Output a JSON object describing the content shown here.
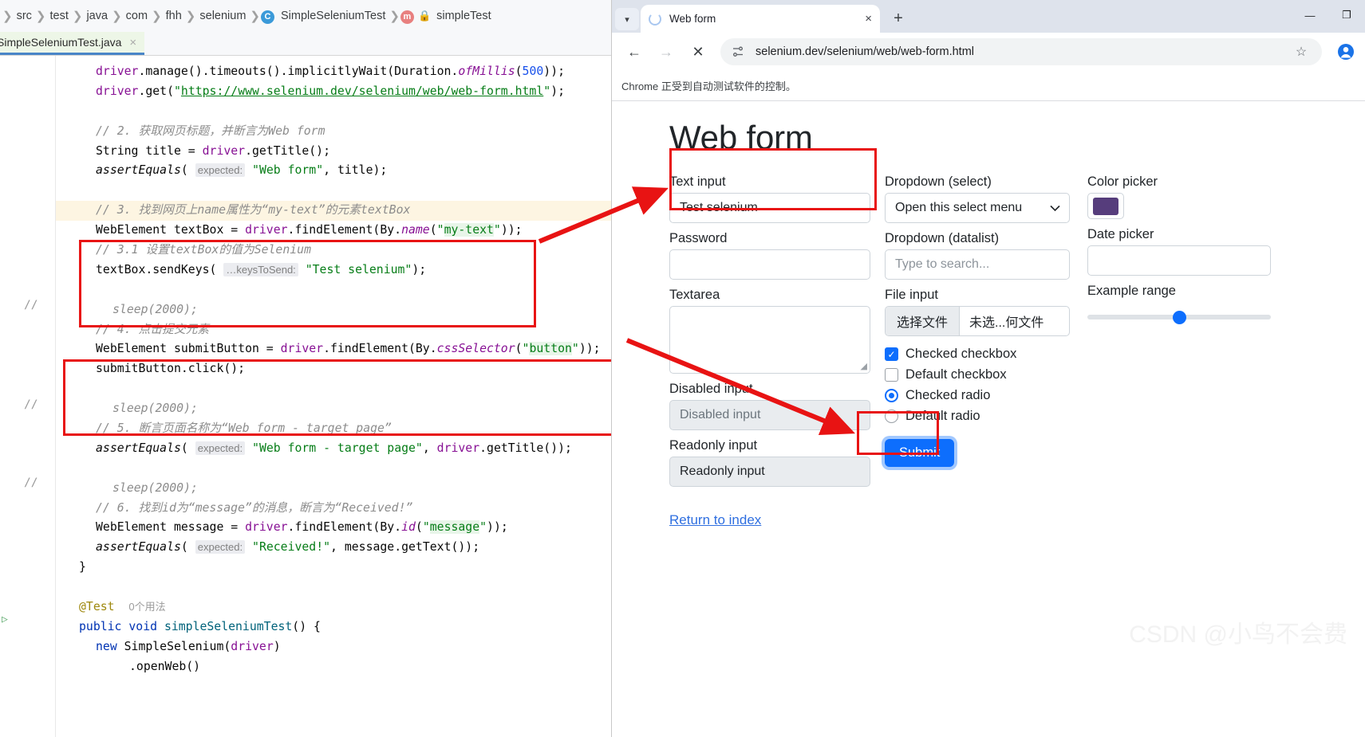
{
  "ide": {
    "breadcrumb": [
      {
        "label": "src",
        "icon": null
      },
      {
        "label": "test",
        "icon": null
      },
      {
        "label": "java",
        "icon": null
      },
      {
        "label": "com",
        "icon": null
      },
      {
        "label": "fhh",
        "icon": null
      },
      {
        "label": "selenium",
        "icon": null
      },
      {
        "label": "SimpleSeleniumTest",
        "icon": "class-icon"
      },
      {
        "label": "simpleTest",
        "icon": "method-icon"
      }
    ],
    "tab": {
      "label": "SimpleSeleniumTest.java",
      "close": "×"
    },
    "code_lines": [
      {
        "indent": 2,
        "html": "<span class='id'>driver</span>.manage().timeouts().implicitlyWait(Duration.<span class='idi'>ofMillis</span>(<span class='n'>500</span>));"
      },
      {
        "indent": 2,
        "html": "<span class='id'>driver</span>.get(<span class='s'>\"</span><span class='link'>https://www.selenium.dev/selenium/web/web-form.html</span><span class='s'>\"</span>);"
      },
      {
        "indent": 0,
        "html": ""
      },
      {
        "indent": 2,
        "html": "<span class='cm'>// 2. 获取网页标题，并断言为Web form</span>"
      },
      {
        "indent": 2,
        "html": "String title = <span class='id'>driver</span>.getTitle();"
      },
      {
        "indent": 2,
        "html": "<span class='ital'>assertEquals</span>( <span class='hint'>expected:</span> <span class='s'>\"Web form\"</span>, title);"
      },
      {
        "indent": 0,
        "html": ""
      },
      {
        "indent": 2,
        "html": "<span class='cm'>// 3. 找到网页上name属性为“my-text”的元素textBox</span>",
        "highlight": true
      },
      {
        "indent": 2,
        "html": "WebElement textBox = <span class='id'>driver</span>.findElement(By.<span class='idi'>name</span>(<span class='s'>\"</span><span class='s green-hl'>my-text</span><span class='s'>\"</span>));"
      },
      {
        "indent": 2,
        "html": "<span class='cm'>// 3.1 设置textBox的值为Selenium</span>"
      },
      {
        "indent": 2,
        "html": "textBox.sendKeys( <span class='hint'>…keysToSend:</span> <span class='s'>\"Test selenium\"</span>);"
      },
      {
        "indent": 0,
        "html": ""
      },
      {
        "indent": 3,
        "html": "<span class='cm'>sleep(2000);</span>"
      },
      {
        "indent": 2,
        "html": "<span class='cm'>// 4. 点击提交元素</span>"
      },
      {
        "indent": 2,
        "html": "WebElement submitButton = <span class='id'>driver</span>.findElement(By.<span class='idi'>cssSelector</span>(<span class='s'>\"</span><span class='s green-hl'>button</span><span class='s'>\"</span>));"
      },
      {
        "indent": 2,
        "html": "submitButton.click();"
      },
      {
        "indent": 0,
        "html": ""
      },
      {
        "indent": 3,
        "html": "<span class='cm'>sleep(2000);</span>"
      },
      {
        "indent": 2,
        "html": "<span class='cm'>// 5. 断言页面名称为“Web form - target page”</span>"
      },
      {
        "indent": 2,
        "html": "<span class='ital'>assertEquals</span>( <span class='hint'>expected:</span> <span class='s'>\"Web form - target page\"</span>, <span class='id'>driver</span>.getTitle());"
      },
      {
        "indent": 0,
        "html": ""
      },
      {
        "indent": 3,
        "html": "<span class='cm'>sleep(2000);</span>"
      },
      {
        "indent": 2,
        "html": "<span class='cm'>// 6. 找到id为“message”的消息，断言为“Received!”</span>"
      },
      {
        "indent": 2,
        "html": "WebElement message = <span class='id'>driver</span>.findElement(By.<span class='idi'>id</span>(<span class='s'>\"</span><span class='s green-hl'>message</span><span class='s'>\"</span>));"
      },
      {
        "indent": 2,
        "html": "<span class='ital'>assertEquals</span>( <span class='hint'>expected:</span> <span class='s'>\"Received!\"</span>, message.getText());"
      },
      {
        "indent": 1,
        "html": "}"
      },
      {
        "indent": 0,
        "html": ""
      },
      {
        "indent": 1,
        "html": "<span class='anno'>@Test</span>&nbsp;&nbsp;<span class='usage'>0个用法</span>"
      },
      {
        "indent": 1,
        "html": "<span class='k'>public</span> <span class='k'>void</span> <span class='fn'>simpleSeleniumTest</span>() {"
      },
      {
        "indent": 2,
        "html": "<span class='k'>new</span> SimpleSelenium(<span class='id'>driver</span>)"
      },
      {
        "indent": 4,
        "html": ".openWeb()"
      }
    ],
    "fold_marks": [
      "//",
      "//",
      "//"
    ]
  },
  "browser": {
    "tab": {
      "title": "Web form",
      "close_label": "×"
    },
    "new_tab_label": "+",
    "window_buttons": {
      "minimize": "—",
      "maximize": "❐",
      "close": "✕"
    },
    "toolbar": {
      "back": "←",
      "forward": "→",
      "stop": "✕",
      "url": "selenium.dev/selenium/web/web-form.html",
      "bookmark": "☆"
    },
    "infobar_text": "Chrome 正受到自动测试软件的控制。"
  },
  "form": {
    "title": "Web form",
    "text_input": {
      "label": "Text input",
      "value": "Test selenium"
    },
    "password": {
      "label": "Password",
      "value": ""
    },
    "textarea": {
      "label": "Textarea",
      "value": ""
    },
    "disabled_input": {
      "label": "Disabled input",
      "placeholder": "Disabled input"
    },
    "readonly_input": {
      "label": "Readonly input",
      "value": "Readonly input"
    },
    "dropdown_select": {
      "label": "Dropdown (select)",
      "value": "Open this select menu",
      "caret": "⌄"
    },
    "dropdown_datalist": {
      "label": "Dropdown (datalist)",
      "placeholder": "Type to search..."
    },
    "file_input": {
      "label": "File input",
      "button": "选择文件",
      "filename": "未选...何文件"
    },
    "checkboxes": [
      {
        "label": "Checked checkbox",
        "checked": true
      },
      {
        "label": "Default checkbox",
        "checked": false
      }
    ],
    "radios": [
      {
        "label": "Checked radio",
        "checked": true
      },
      {
        "label": "Default radio",
        "checked": false
      }
    ],
    "submit": {
      "label": "Submit"
    },
    "color_picker": {
      "label": "Color picker",
      "value": "#563d7c"
    },
    "date_picker": {
      "label": "Date picker",
      "value": ""
    },
    "range": {
      "label": "Example range",
      "value": 5,
      "min": 0,
      "max": 10,
      "percent": 50
    },
    "return_link": {
      "label": "Return to index"
    }
  },
  "watermark": {
    "text": "CSDN @小鸟不会费"
  },
  "colors": {
    "accent_blue": "#0d6efd",
    "annotation_red": "#e81313",
    "color_picker_swatch": "#563d7c"
  }
}
